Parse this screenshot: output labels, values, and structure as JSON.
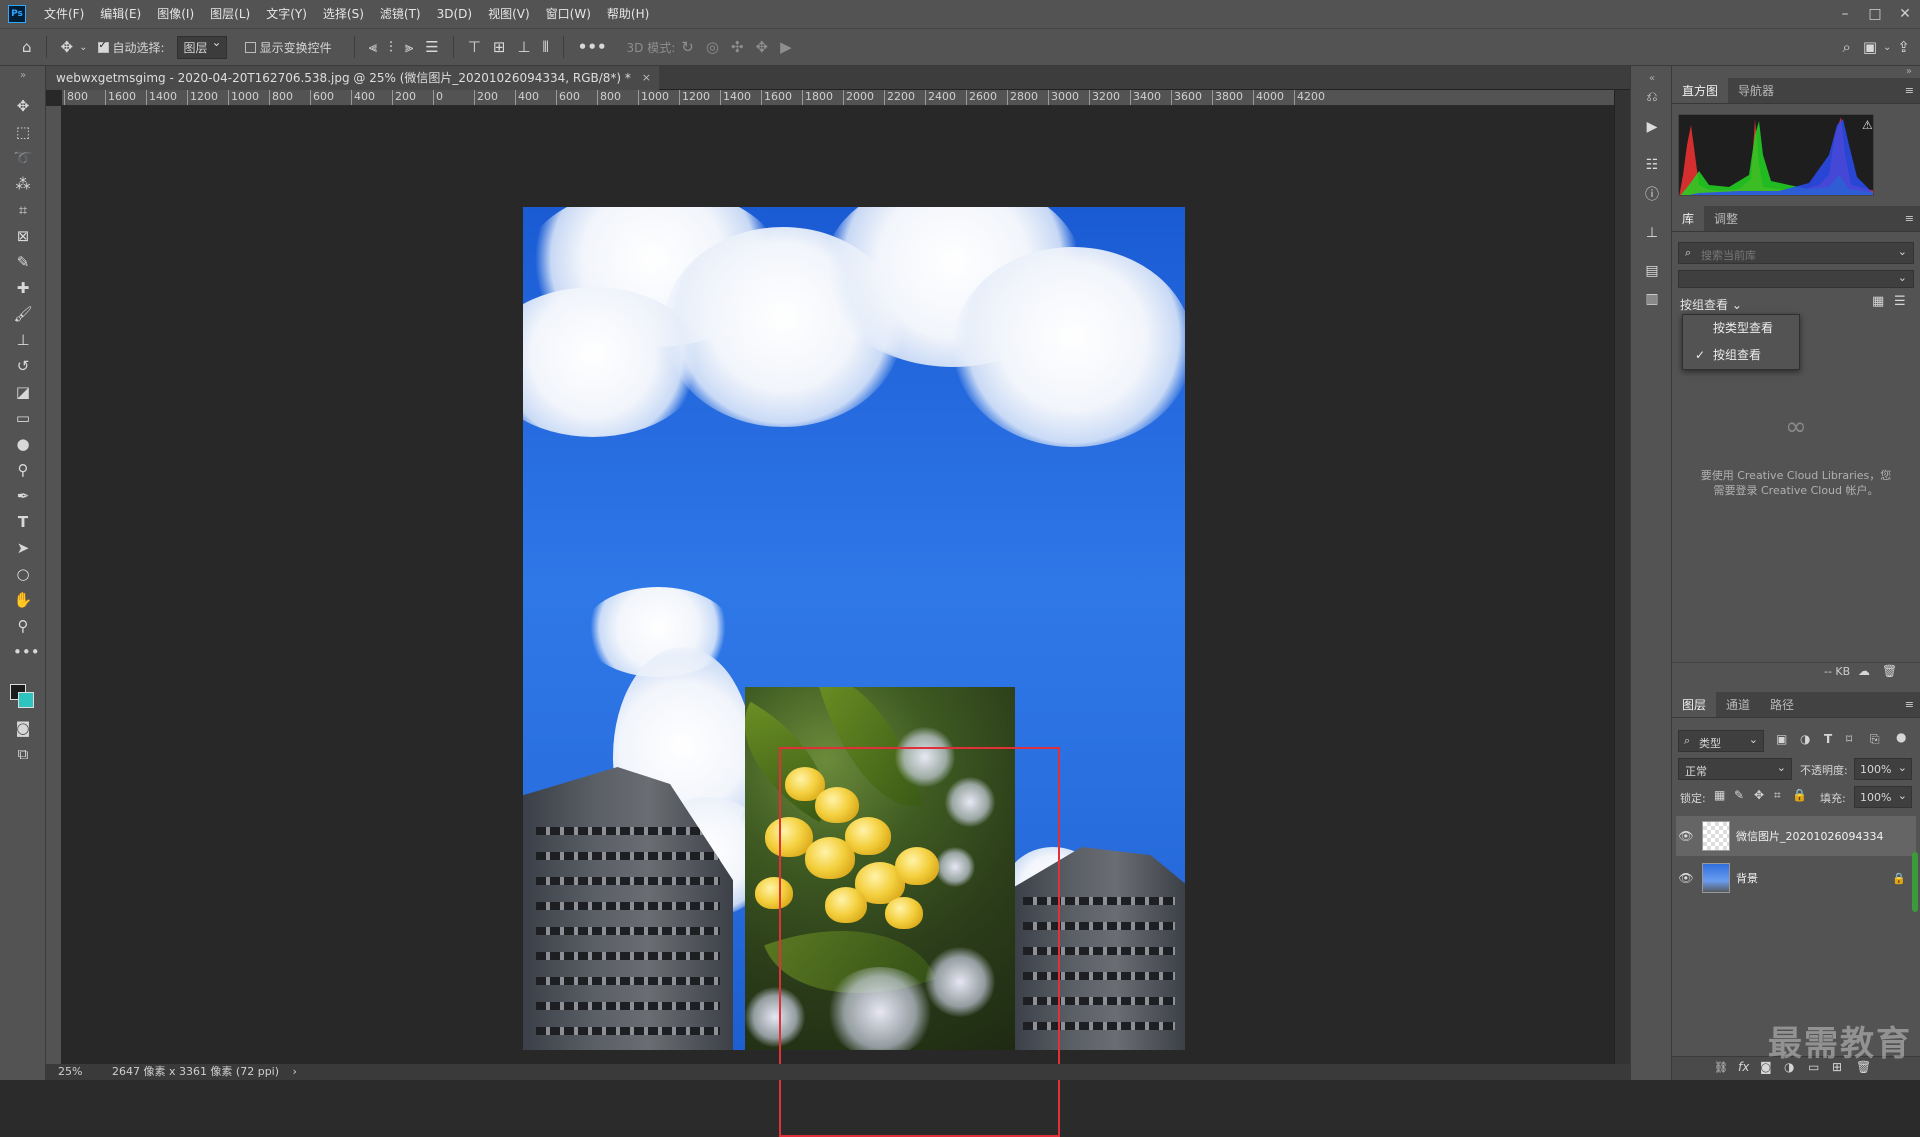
{
  "app": {
    "logo": "Ps"
  },
  "menu": [
    "文件(F)",
    "编辑(E)",
    "图像(I)",
    "图层(L)",
    "文字(Y)",
    "选择(S)",
    "滤镜(T)",
    "3D(D)",
    "视图(V)",
    "窗口(W)",
    "帮助(H)"
  ],
  "window_controls": [
    "–",
    "□",
    "✕"
  ],
  "options": {
    "auto_select_label": "自动选择:",
    "auto_select_value": "图层",
    "show_transform_label": "显示变换控件",
    "more": "•••",
    "mode_3d_label": "3D 模式:"
  },
  "document": {
    "tab_title": "webwxgetmsgimg - 2020-04-20T162706.538.jpg @ 25% (微信图片_20201026094334, RGB/8*) *",
    "tab_close": "×",
    "ruler_labels": [
      "800",
      "1600",
      "1400",
      "1200",
      "1000",
      "800",
      "600",
      "400",
      "200",
      "0",
      "200",
      "400",
      "600",
      "800",
      "1000",
      "1200",
      "1400",
      "1600",
      "1800",
      "2000",
      "2200",
      "2400",
      "2600",
      "2800",
      "3000",
      "3200",
      "3400",
      "3600",
      "3800",
      "4000",
      "4200"
    ],
    "status_zoom": "25%",
    "status_info": "2647 像素 x 3361 像素 (72 ppi)",
    "status_arrow": "›"
  },
  "panels": {
    "histogram_tabs": [
      "直方图",
      "导航器"
    ],
    "library_tabs": [
      "库",
      "调整"
    ],
    "search_placeholder": "搜索当前库",
    "view_by_label": "按组查看 ⌄",
    "view_menu": [
      {
        "label": "按类型查看",
        "checked": false
      },
      {
        "label": "按组查看",
        "checked": true
      }
    ],
    "cc_message_line1": "要使用 Creative Cloud Libraries，您",
    "cc_message_line2": "需要登录 Creative Cloud 帐户。",
    "kb_label": "-- KB",
    "layer_tabs": [
      "图层",
      "通道",
      "路径"
    ],
    "layer_filter": "类型",
    "blend_mode": "正常",
    "opacity_label": "不透明度:",
    "opacity_value": "100%",
    "lock_label": "锁定:",
    "fill_label": "填充:",
    "fill_value": "100%",
    "layers": [
      {
        "name": "微信图片_20201026094334",
        "selected": true,
        "locked": false
      },
      {
        "name": "背景",
        "selected": false,
        "locked": true
      }
    ]
  },
  "watermark": "最需教育",
  "colors": {
    "selection": "#e0313a",
    "ui_bg": "#535353",
    "canvas_bg": "#282828"
  }
}
